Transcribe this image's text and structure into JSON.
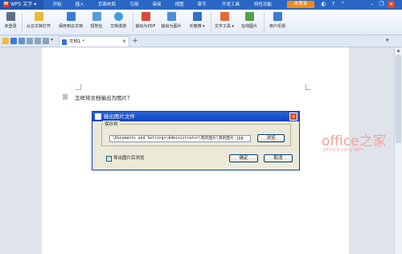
{
  "app": {
    "name": "WPS 文字"
  },
  "menu": {
    "items": [
      "开始",
      "插入",
      "页面布局",
      "引用",
      "审阅",
      "视图",
      "章节",
      "开发工具",
      "特色功能"
    ],
    "login": "未登录"
  },
  "toolbar": {
    "tools": [
      "未登录",
      "从云文档打开",
      "保存到云文档",
      "短地址",
      "文档漫游",
      "输出为PDF",
      "输出为图片",
      "长微博",
      "文字工具",
      "在线图片",
      "用户反馈"
    ]
  },
  "tabs": {
    "doc_name": "文档1 *"
  },
  "document": {
    "text": "怎样将文档输出为图片？"
  },
  "dialog": {
    "title": "输出图片文件",
    "group_label": "保存到",
    "path": "\\Documents and Settings\\Administrator\\我的图片\\我的图片.jpg",
    "browse": "浏览",
    "checkbox_label": "导出图片后浏览",
    "ok": "确定",
    "cancel": "取消"
  },
  "watermark": {
    "main": "office之家",
    "sub": "OFFICE.JB51.NET"
  },
  "colors": {
    "menubar": "#2a67c4",
    "accent": "#f08a1c",
    "dialog_title": "#0c44c0"
  }
}
